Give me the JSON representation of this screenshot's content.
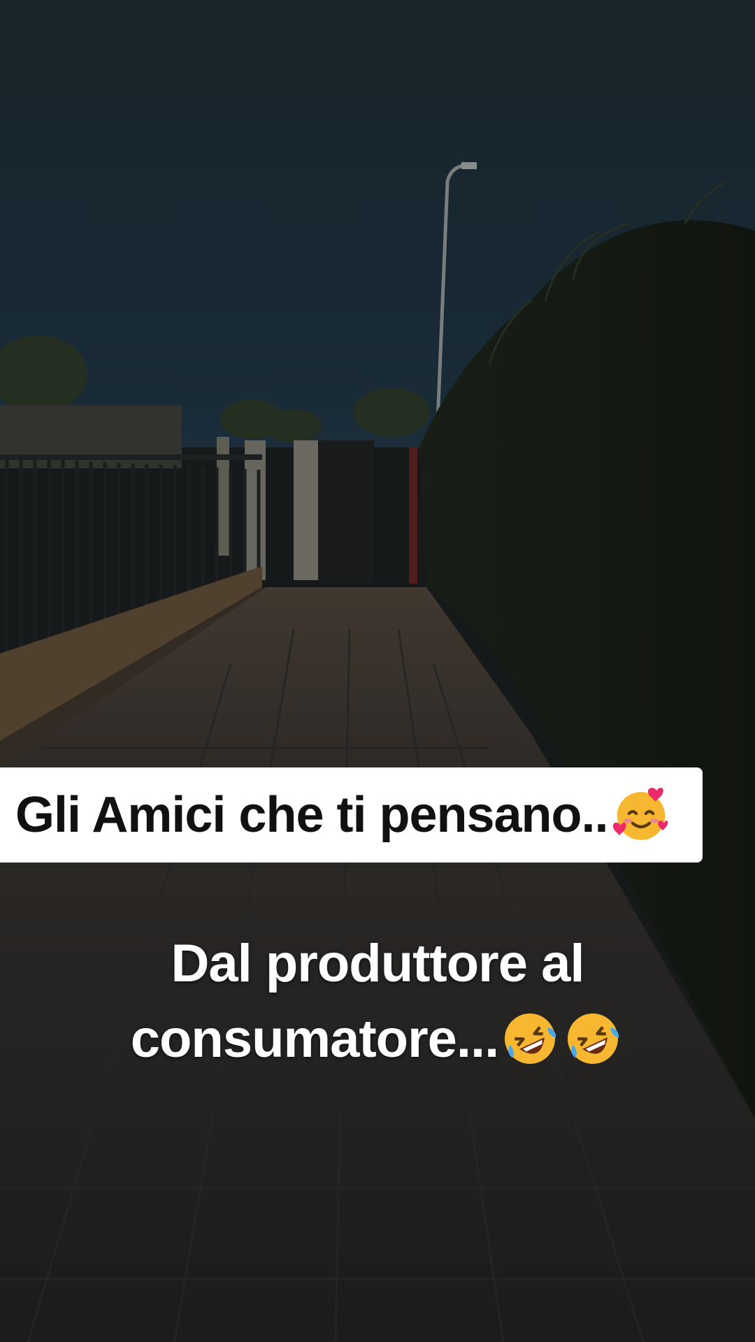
{
  "caption": {
    "text": "Gli Amici che ti pensano..",
    "emoji": "smiling-face-with-hearts"
  },
  "overlay": {
    "line1": "Dal produttore al",
    "line2": "consumatore...",
    "emojis": [
      "rolling-on-floor-laughing",
      "rolling-on-floor-laughing"
    ]
  },
  "colors": {
    "sky": "#1c2b33",
    "caption_bg": "#ffffff",
    "caption_text": "#111111",
    "overlay_text": "#ffffff"
  }
}
